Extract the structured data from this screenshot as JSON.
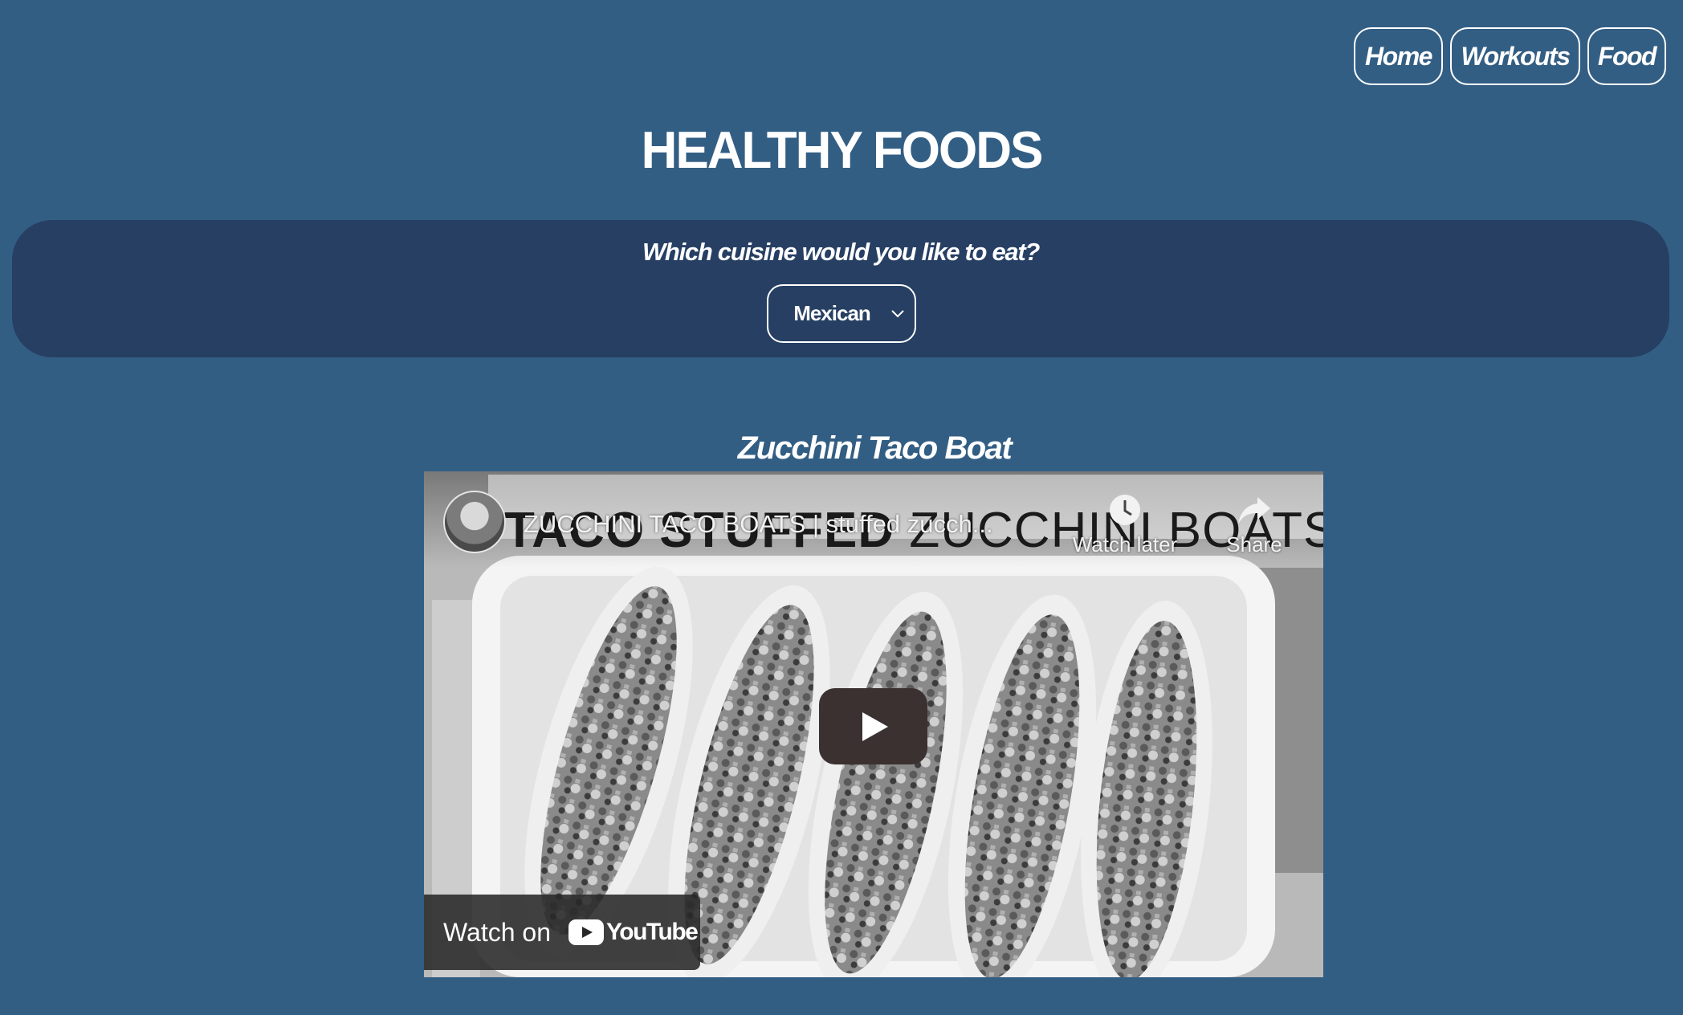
{
  "nav": {
    "items": [
      {
        "label": "Home"
      },
      {
        "label": "Workouts"
      },
      {
        "label": "Food"
      }
    ]
  },
  "header": {
    "title": "HEALTHY FOODS"
  },
  "cuisine": {
    "question": "Which cuisine would you like to eat?",
    "selected": "Mexican"
  },
  "recipe": {
    "title": "Zucchini Taco Boat",
    "video": {
      "title": "ZUCCHINI TACO BOATS | stuffed zucch...",
      "thumbnail_text_bold": "TACO STUFFED",
      "thumbnail_text_light": "ZUCCHINI BOATS",
      "watch_later_label": "Watch later",
      "share_label": "Share",
      "watch_on_label": "Watch on",
      "brand_label": "YouTube"
    }
  },
  "colors": {
    "background": "#335e84",
    "panel": "#263f63",
    "text": "#ffffff"
  }
}
